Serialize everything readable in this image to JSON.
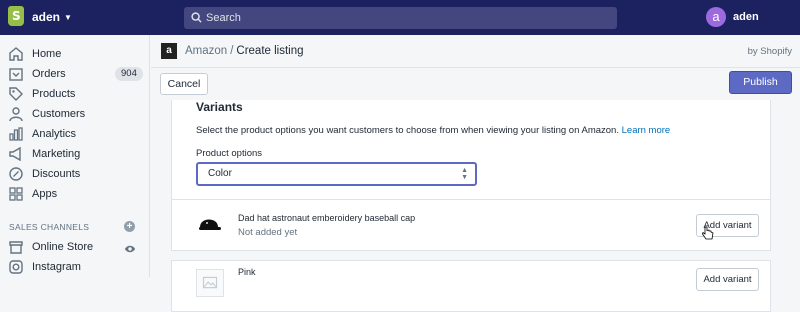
{
  "topbar": {
    "store_name": "aden",
    "search_placeholder": "Search",
    "avatar_letter": "a",
    "user_name": "aden"
  },
  "sidebar": {
    "items": [
      {
        "label": "Home",
        "icon": "home-icon"
      },
      {
        "label": "Orders",
        "icon": "orders-icon",
        "badge": "904"
      },
      {
        "label": "Products",
        "icon": "tag-icon"
      },
      {
        "label": "Customers",
        "icon": "person-icon"
      },
      {
        "label": "Analytics",
        "icon": "bar-chart-icon"
      },
      {
        "label": "Marketing",
        "icon": "megaphone-icon"
      },
      {
        "label": "Discounts",
        "icon": "discount-icon"
      },
      {
        "label": "Apps",
        "icon": "apps-icon"
      }
    ],
    "section_title": "SALES CHANNELS",
    "channels": [
      {
        "label": "Online Store",
        "icon": "store-icon"
      },
      {
        "label": "Instagram",
        "icon": "instagram-icon"
      }
    ]
  },
  "app_header": {
    "app_name": "Amazon",
    "separator": "/",
    "current": "Create listing",
    "by": "by Shopify"
  },
  "actions": {
    "cancel": "Cancel",
    "publish": "Publish"
  },
  "variants_card": {
    "title": "Variants",
    "description": "Select the product options you want customers to choose from when viewing your listing on Amazon.",
    "learn_more": "Learn more",
    "options_label": "Product options",
    "selected_option": "Color"
  },
  "variants": [
    {
      "name": "Dad hat astronaut emberoidery baseball cap",
      "status": "Not added yet",
      "button": "Add variant"
    },
    {
      "name": "Pink",
      "button": "Add variant"
    }
  ],
  "colors": {
    "topbar": "#1c2260",
    "primary": "#5c6ac4",
    "link": "#006fbb"
  }
}
